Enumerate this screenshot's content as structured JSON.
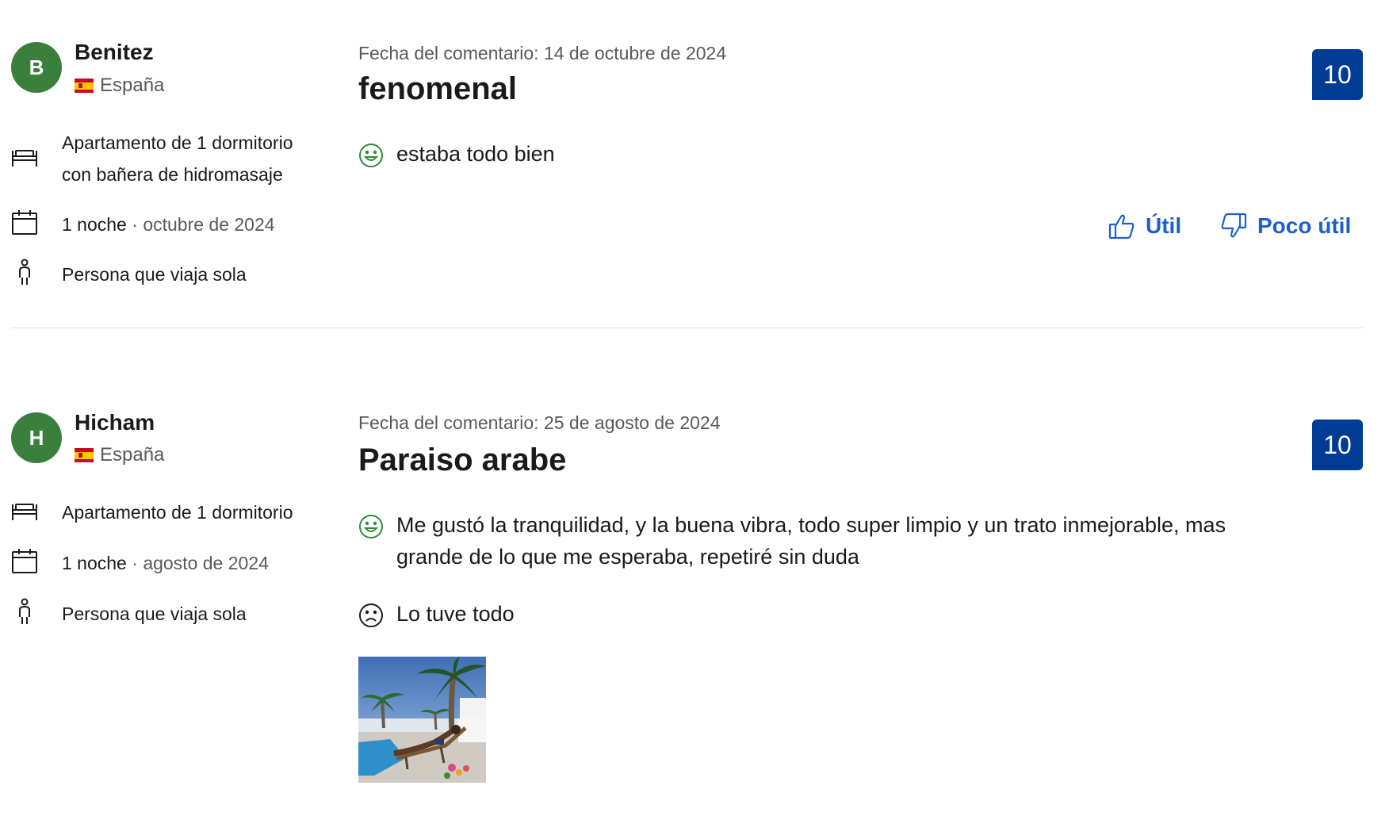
{
  "reviews": [
    {
      "initial": "B",
      "name": "Benitez",
      "country": "España",
      "room": "Apartamento de 1 dormitorio con bañera de hidromasaje",
      "nights": "1 noche",
      "stay_date": "octubre de 2024",
      "traveler": "Persona que viaja sola",
      "date": "Fecha del comentario: 14 de octubre de 2024",
      "title": "fenomenal",
      "positive": "estaba todo bien",
      "score": "10",
      "helpful_label": "Útil",
      "unhelpful_label": "Poco útil"
    },
    {
      "initial": "H",
      "name": "Hicham",
      "country": "España",
      "room": "Apartamento de 1 dormitorio",
      "nights": "1 noche",
      "stay_date": "agosto de 2024",
      "traveler": "Persona que viaja sola",
      "date": "Fecha del comentario: 25 de agosto de 2024",
      "title": "Paraiso arabe",
      "positive": "Me gustó la tranquilidad, y la buena vibra, todo super limpio y un trato inmejorable, mas grande de lo que me esperaba, repetiré sin duda",
      "negative": "Lo tuve todo",
      "score": "10"
    }
  ],
  "colors": {
    "avatar": "#3a7f3b",
    "score": "#003b95",
    "link": "#1c5fce",
    "positive_icon": "#2e8b3a",
    "muted": "#595959"
  },
  "icons": [
    "bed-icon",
    "calendar-icon",
    "traveler-icon",
    "smile-icon",
    "frown-icon",
    "thumbs-up-icon",
    "thumbs-down-icon",
    "spain-flag-icon"
  ]
}
